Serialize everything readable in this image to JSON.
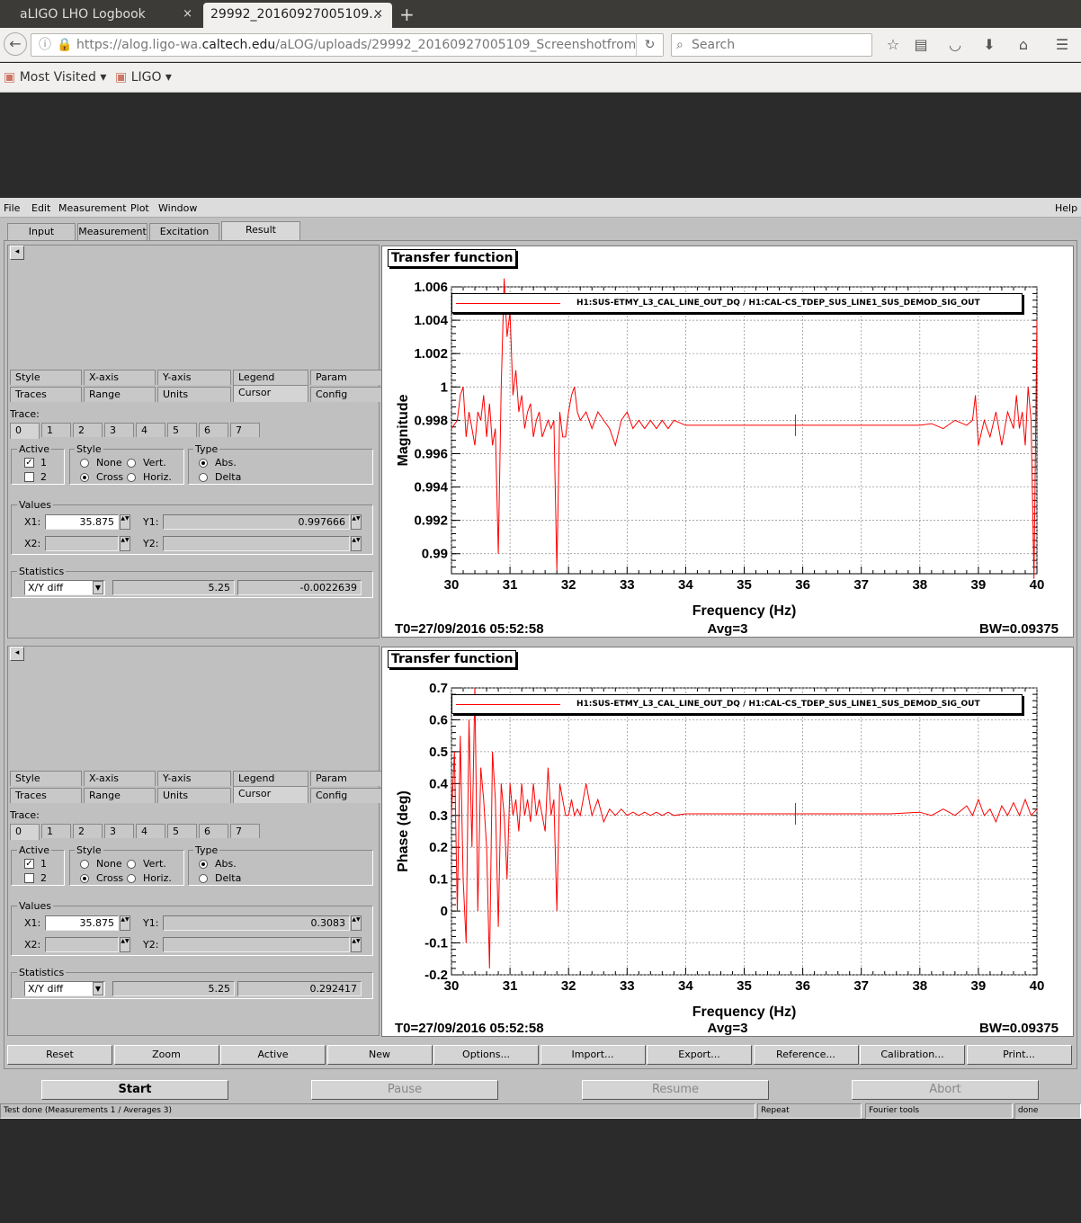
{
  "browser": {
    "tabs": [
      {
        "title": "aLIGO LHO Logbook",
        "close": "×"
      },
      {
        "title": "29992_20160927005109...",
        "close": "×"
      }
    ],
    "new_tab": "+",
    "url": "https://alog.ligo-wa.caltech.edu/aLOG/uploads/29992_20160927005109_Screenshotfrom",
    "url_prefix": "https://alog.ligo-wa.",
    "url_domain": "caltech.edu",
    "url_rest": "/aLOG/uploads/29992_20160927005109_Screenshotfrom",
    "search_placeholder": "Search",
    "bookmarks": [
      "Most Visited ▾",
      "LIGO ▾"
    ]
  },
  "app": {
    "menus": [
      "File",
      "Edit",
      "Measurement",
      "Plot",
      "Window"
    ],
    "help": "Help",
    "tabs": [
      "Input",
      "Measurement",
      "Excitation",
      "Result"
    ],
    "panel_tabs_row1": [
      "Style",
      "X-axis",
      "Y-axis",
      "Legend",
      "Param"
    ],
    "panel_tabs_row2": [
      "Traces",
      "Range",
      "Units",
      "Cursor",
      "Config"
    ],
    "trace_label": "Trace:",
    "trace_nums": [
      "0",
      "1",
      "2",
      "3",
      "4",
      "5",
      "6",
      "7"
    ],
    "active_label": "Active",
    "active_items": [
      "1",
      "2"
    ],
    "style_label": "Style",
    "style_items": [
      "None",
      "Vert.",
      "Cross",
      "Horiz."
    ],
    "type_label": "Type",
    "type_items": [
      "Abs.",
      "Delta"
    ],
    "values_label": "Values",
    "x1_label": "X1:",
    "x2_label": "X2:",
    "y1_label": "Y1:",
    "y2_label": "Y2:",
    "statistics_label": "Statistics",
    "stat_select": "X/Y diff",
    "panels": [
      {
        "x1": "35.875",
        "y1": "0.997666",
        "stat_x": "5.25",
        "stat_y": "-0.0022639"
      },
      {
        "x1": "35.875",
        "y1": "0.3083",
        "stat_x": "5.25",
        "stat_y": "0.292417"
      }
    ],
    "bottom_buttons": [
      "Reset",
      "Zoom",
      "Active",
      "New",
      "Options...",
      "Import...",
      "Export...",
      "Reference...",
      "Calibration...",
      "Print..."
    ],
    "control_buttons": [
      "Start",
      "Pause",
      "Resume",
      "Abort"
    ],
    "status": [
      "Test done (Measurements 1 / Averages 3)",
      "Repeat",
      "Fourier tools",
      "done"
    ]
  },
  "plots": [
    {
      "title": "Transfer function",
      "legend": "H1:SUS-ETMY_L3_CAL_LINE_OUT_DQ / H1:CAL-CS_TDEP_SUS_LINE1_SUS_DEMOD_SIG_OUT",
      "xlabel": "Frequency (Hz)",
      "ylabel": "Magnitude",
      "xticks": [
        "30",
        "31",
        "32",
        "33",
        "34",
        "35",
        "36",
        "37",
        "38",
        "39",
        "40"
      ],
      "yticks": [
        "0.99",
        "0.992",
        "0.994",
        "0.996",
        "0.998",
        "1",
        "1.002",
        "1.004",
        "1.006"
      ],
      "footer_left": "T0=27/09/2016 05:52:58",
      "footer_mid": "Avg=3",
      "footer_right": "BW=0.09375"
    },
    {
      "title": "Transfer function",
      "legend": "H1:SUS-ETMY_L3_CAL_LINE_OUT_DQ / H1:CAL-CS_TDEP_SUS_LINE1_SUS_DEMOD_SIG_OUT",
      "xlabel": "Frequency (Hz)",
      "ylabel": "Phase (deg)",
      "xticks": [
        "30",
        "31",
        "32",
        "33",
        "34",
        "35",
        "36",
        "37",
        "38",
        "39",
        "40"
      ],
      "yticks": [
        "-0.2",
        "-0.1",
        "0",
        "0.1",
        "0.2",
        "0.3",
        "0.4",
        "0.5",
        "0.6",
        "0.7"
      ],
      "footer_left": "T0=27/09/2016 05:52:58",
      "footer_mid": "Avg=3",
      "footer_right": "BW=0.09375"
    }
  ],
  "chart_data": [
    {
      "type": "line",
      "title": "Transfer function",
      "xlabel": "Frequency (Hz)",
      "ylabel": "Magnitude",
      "xlim": [
        30,
        40
      ],
      "ylim": [
        0.9888,
        1.006
      ],
      "grid": true,
      "legend_position": "top",
      "series": [
        {
          "name": "H1:SUS-ETMY_L3_CAL_LINE_OUT_DQ / H1:CAL-CS_TDEP_SUS_LINE1_SUS_DEMOD_SIG_OUT",
          "color": "#ff0000",
          "x": [
            30.0,
            30.1,
            30.15,
            30.2,
            30.25,
            30.3,
            30.35,
            30.4,
            30.45,
            30.5,
            30.55,
            30.6,
            30.65,
            30.7,
            30.75,
            30.8,
            30.85,
            30.9,
            30.95,
            31.0,
            31.05,
            31.1,
            31.15,
            31.2,
            31.25,
            31.3,
            31.35,
            31.4,
            31.45,
            31.5,
            31.55,
            31.6,
            31.65,
            31.7,
            31.75,
            31.8,
            31.85,
            31.9,
            31.95,
            32.0,
            32.05,
            32.1,
            32.15,
            32.2,
            32.3,
            32.4,
            32.5,
            32.6,
            32.7,
            32.8,
            32.9,
            33.0,
            33.1,
            33.2,
            33.3,
            33.4,
            33.5,
            33.6,
            33.7,
            33.8,
            34.0,
            34.5,
            35.0,
            35.5,
            35.87,
            36.0,
            36.5,
            37.0,
            37.5,
            38.0,
            38.2,
            38.4,
            38.6,
            38.8,
            38.9,
            38.95,
            39.0,
            39.1,
            39.2,
            39.3,
            39.4,
            39.5,
            39.6,
            39.65,
            39.7,
            39.75,
            39.8,
            39.85,
            39.9,
            39.95,
            40.0
          ],
          "y": [
            0.9975,
            0.998,
            0.9995,
            1.0,
            0.997,
            0.9985,
            0.9975,
            0.9965,
            0.9985,
            0.998,
            0.9995,
            0.997,
            0.999,
            0.9965,
            0.9975,
            0.99,
            1.0,
            1.0065,
            1.003,
            1.0045,
            0.9995,
            1.001,
            0.9985,
            0.9995,
            0.9975,
            0.9985,
            0.999,
            0.997,
            0.998,
            0.9985,
            0.997,
            0.9975,
            0.998,
            0.9975,
            0.998,
            0.989,
            0.9985,
            0.997,
            0.997,
            0.9985,
            0.9995,
            1.0,
            0.9985,
            0.998,
            0.9985,
            0.9975,
            0.9985,
            0.998,
            0.9975,
            0.9965,
            0.998,
            0.9985,
            0.9975,
            0.998,
            0.9975,
            0.998,
            0.9975,
            0.998,
            0.9975,
            0.998,
            0.9977,
            0.9977,
            0.9977,
            0.9977,
            0.9977,
            0.9977,
            0.9977,
            0.9977,
            0.9977,
            0.9977,
            0.9978,
            0.9975,
            0.998,
            0.9977,
            0.998,
            0.9995,
            0.9965,
            0.998,
            0.997,
            0.9985,
            0.9965,
            0.9985,
            0.9975,
            0.9995,
            0.9975,
            0.9985,
            0.9965,
            1.0,
            0.998,
            0.9885,
            1.004
          ]
        }
      ]
    },
    {
      "type": "line",
      "title": "Transfer function",
      "xlabel": "Frequency (Hz)",
      "ylabel": "Phase (deg)",
      "xlim": [
        30,
        40
      ],
      "ylim": [
        -0.2,
        0.7
      ],
      "grid": true,
      "legend_position": "top",
      "series": [
        {
          "name": "H1:SUS-ETMY_L3_CAL_LINE_OUT_DQ / H1:CAL-CS_TDEP_SUS_LINE1_SUS_DEMOD_SIG_OUT",
          "color": "#ff0000",
          "x": [
            30.0,
            30.05,
            30.1,
            30.15,
            30.2,
            30.25,
            30.3,
            30.35,
            30.4,
            30.45,
            30.5,
            30.55,
            30.6,
            30.65,
            30.7,
            30.75,
            30.8,
            30.85,
            30.9,
            30.95,
            31.0,
            31.05,
            31.1,
            31.15,
            31.2,
            31.25,
            31.3,
            31.35,
            31.4,
            31.45,
            31.5,
            31.55,
            31.6,
            31.65,
            31.7,
            31.75,
            31.8,
            31.85,
            31.9,
            31.95,
            32.0,
            32.05,
            32.1,
            32.15,
            32.2,
            32.3,
            32.4,
            32.5,
            32.6,
            32.7,
            32.8,
            32.9,
            33.0,
            33.1,
            33.2,
            33.3,
            33.4,
            33.5,
            33.6,
            33.7,
            33.8,
            34.0,
            34.5,
            35.0,
            35.5,
            35.87,
            36.0,
            36.5,
            37.0,
            37.5,
            38.0,
            38.2,
            38.4,
            38.6,
            38.8,
            38.9,
            39.0,
            39.1,
            39.2,
            39.3,
            39.4,
            39.5,
            39.6,
            39.7,
            39.8,
            39.9,
            40.0
          ],
          "y": [
            0.3,
            0.5,
            0.0,
            0.55,
            0.1,
            -0.1,
            0.6,
            0.2,
            0.7,
            0.0,
            0.45,
            0.35,
            0.2,
            -0.18,
            0.5,
            0.35,
            -0.05,
            0.4,
            0.3,
            0.1,
            0.4,
            0.3,
            0.35,
            0.25,
            0.4,
            0.3,
            0.35,
            0.28,
            0.4,
            0.3,
            0.35,
            0.3,
            0.25,
            0.45,
            0.3,
            0.35,
            0.0,
            0.4,
            0.35,
            0.3,
            0.3,
            0.35,
            0.3,
            0.32,
            0.3,
            0.4,
            0.3,
            0.35,
            0.28,
            0.32,
            0.3,
            0.32,
            0.3,
            0.31,
            0.3,
            0.31,
            0.3,
            0.31,
            0.3,
            0.31,
            0.3,
            0.305,
            0.305,
            0.305,
            0.305,
            0.305,
            0.305,
            0.305,
            0.305,
            0.305,
            0.31,
            0.3,
            0.32,
            0.3,
            0.33,
            0.3,
            0.35,
            0.3,
            0.32,
            0.28,
            0.33,
            0.3,
            0.34,
            0.3,
            0.35,
            0.3,
            0.32
          ]
        }
      ]
    }
  ]
}
